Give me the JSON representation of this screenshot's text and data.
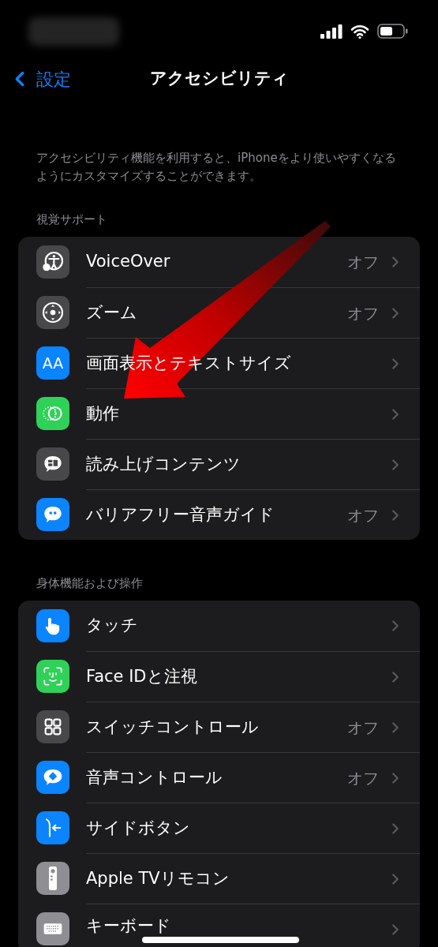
{
  "nav": {
    "back": "設定",
    "title": "アクセシビリティ"
  },
  "description": "アクセシビリティ機能を利用すると、iPhoneをより使いやすくなるようにカスタマイズすることができます。",
  "sections": [
    {
      "header": "視覚サポート",
      "rows": [
        {
          "label": "VoiceOver",
          "value": "オフ",
          "kind": "voiceover",
          "color": "#48484a"
        },
        {
          "label": "ズーム",
          "value": "オフ",
          "kind": "zoom",
          "color": "#48484a"
        },
        {
          "label": "画面表示とテキストサイズ",
          "kind": "text",
          "glyph": "AA",
          "color": "#0a84ff"
        },
        {
          "label": "動作",
          "kind": "motion",
          "color": "#30d158"
        },
        {
          "label": "読み上げコンテンツ",
          "kind": "speech",
          "color": "#48484a"
        },
        {
          "label": "バリアフリー音声ガイド",
          "value": "オフ",
          "kind": "quote",
          "color": "#0a84ff"
        }
      ]
    },
    {
      "header": "身体機能および操作",
      "rows": [
        {
          "label": "タッチ",
          "kind": "touch",
          "color": "#0a84ff"
        },
        {
          "label": "Face IDと注視",
          "kind": "faceid",
          "color": "#30d158"
        },
        {
          "label": "スイッチコントロール",
          "value": "オフ",
          "kind": "switch",
          "color": "#48484a"
        },
        {
          "label": "音声コントロール",
          "value": "オフ",
          "kind": "voice",
          "color": "#0a84ff"
        },
        {
          "label": "サイドボタン",
          "kind": "side",
          "color": "#0a84ff"
        },
        {
          "label": "Apple TVリモコン",
          "kind": "remote",
          "color": "#8e8e93"
        },
        {
          "label": "キーボード",
          "kind": "keyboard",
          "color": "#8e8e93"
        }
      ]
    }
  ]
}
